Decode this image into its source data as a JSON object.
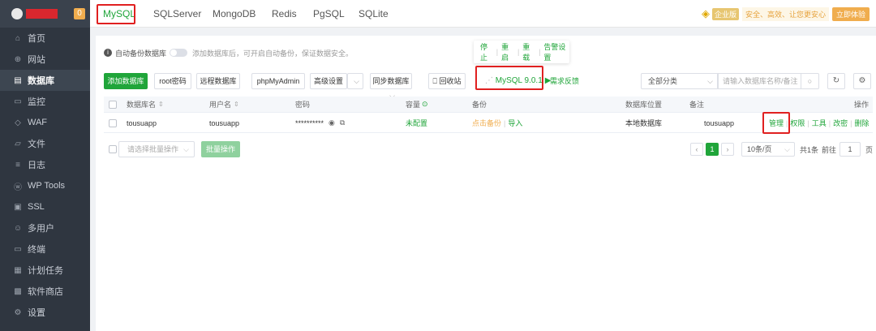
{
  "sidebar": {
    "badge": "0",
    "items": [
      {
        "label": "首页",
        "icon": "home-icon",
        "glyph": "⌂"
      },
      {
        "label": "网站",
        "icon": "globe-icon",
        "glyph": "⊕"
      },
      {
        "label": "数据库",
        "icon": "database-icon",
        "glyph": "▤",
        "active": true
      },
      {
        "label": "监控",
        "icon": "monitor-icon",
        "glyph": "▭"
      },
      {
        "label": "WAF",
        "icon": "shield-icon",
        "glyph": "◇"
      },
      {
        "label": "文件",
        "icon": "folder-icon",
        "glyph": "▱"
      },
      {
        "label": "日志",
        "icon": "log-icon",
        "glyph": "≡"
      },
      {
        "label": "WP Tools",
        "icon": "wordpress-icon",
        "glyph": "ⓦ"
      },
      {
        "label": "SSL",
        "icon": "certificate-icon",
        "glyph": "▣"
      },
      {
        "label": "多用户",
        "icon": "users-icon",
        "glyph": "☺"
      },
      {
        "label": "终端",
        "icon": "terminal-icon",
        "glyph": "▭"
      },
      {
        "label": "计划任务",
        "icon": "calendar-icon",
        "glyph": "▦"
      },
      {
        "label": "软件商店",
        "icon": "store-icon",
        "glyph": "▩"
      },
      {
        "label": "设置",
        "icon": "gear-icon",
        "glyph": "⚙"
      }
    ]
  },
  "tabs": [
    "MySQL",
    "SQLServer",
    "MongoDB",
    "Redis",
    "PgSQL",
    "SQLite"
  ],
  "promo": {
    "enterprise": "企业版",
    "text": "安全、高效、让您更安心",
    "button": "立即体验"
  },
  "backup": {
    "label": "自动备份数据库",
    "hint": "添加数据库后，可开启自动备份，保证数据安全。"
  },
  "service_menu": {
    "stop": "停止",
    "restart": "重启",
    "reload": "重载",
    "settings": "告警设置"
  },
  "toolbar": {
    "add_db": "添加数据库",
    "root_pwd": "root密码",
    "remote_db": "远程数据库",
    "phpmyadmin": "phpMyAdmin",
    "advanced": "高级设置",
    "sync": "同步数据库",
    "recycle": "回收站",
    "mysql_version": "MySQL 9.0.1",
    "feedback": "需求反馈",
    "category": "全部分类",
    "search_placeholder": "请输入数据库名称/备注"
  },
  "table": {
    "headers": {
      "name": "数据库名",
      "user": "用户名",
      "password": "密码",
      "capacity": "容量",
      "backup": "备份",
      "location": "数据库位置",
      "note": "备注",
      "ops": "操作"
    },
    "rows": [
      {
        "name": "tousuapp",
        "user": "tousuapp",
        "password": "**********",
        "capacity": "未配置",
        "backup_none": "点击备份",
        "backup_import": "导入",
        "location": "本地数据库",
        "note": "tousuapp",
        "ops": [
          "管理",
          "权限",
          "工具",
          "改密",
          "删除"
        ]
      }
    ]
  },
  "footer": {
    "batch_placeholder": "请选择批量操作",
    "batch_button": "批量操作",
    "page": "1",
    "page_size": "10条/页",
    "total": "共1条",
    "goto": "前往",
    "goto_value": "1",
    "page_unit": "页"
  }
}
